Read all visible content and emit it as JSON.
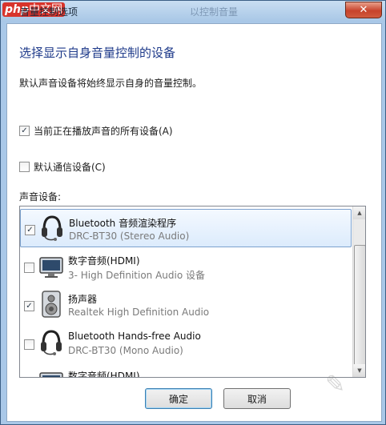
{
  "window": {
    "title": "音量控制选项",
    "title_ghost_left": "音量",
    "title_ghost_right": "以控制音量",
    "logo_text": "php",
    "logo_cn": "中文网",
    "close_label": "✕"
  },
  "heading": "选择显示自身音量控制的设备",
  "description": "默认声音设备将始终显示自身的音量控制。",
  "options": {
    "all_playing": {
      "label": "当前正在播放声音的所有设备(A)",
      "checked": true
    },
    "default_comm": {
      "label": "默认通信设备(C)",
      "checked": false
    }
  },
  "devices_label": "声音设备:",
  "devices": [
    {
      "name": "Bluetooth 音频渲染程序",
      "detail": "DRC-BT30 (Stereo Audio)",
      "icon": "headset-icon",
      "checked": true,
      "selected": true
    },
    {
      "name": "数字音频(HDMI)",
      "detail": "3- High Definition Audio 设备",
      "icon": "monitor-icon",
      "checked": false,
      "selected": false
    },
    {
      "name": "扬声器",
      "detail": "Realtek High Definition Audio",
      "icon": "speaker-icon",
      "checked": true,
      "selected": false
    },
    {
      "name": "Bluetooth Hands-free Audio",
      "detail": "DRC-BT30 (Mono Audio)",
      "icon": "headset-icon",
      "checked": false,
      "selected": false
    },
    {
      "name": "数字音频(HDMI)",
      "detail": "",
      "icon": "monitor-icon",
      "checked": false,
      "selected": false
    }
  ],
  "buttons": {
    "ok": "确定",
    "cancel": "取消"
  },
  "check_glyph": "✓",
  "colors": {
    "heading": "#1e3a8a",
    "selection": "#dcebfc",
    "close": "#c7432c"
  }
}
